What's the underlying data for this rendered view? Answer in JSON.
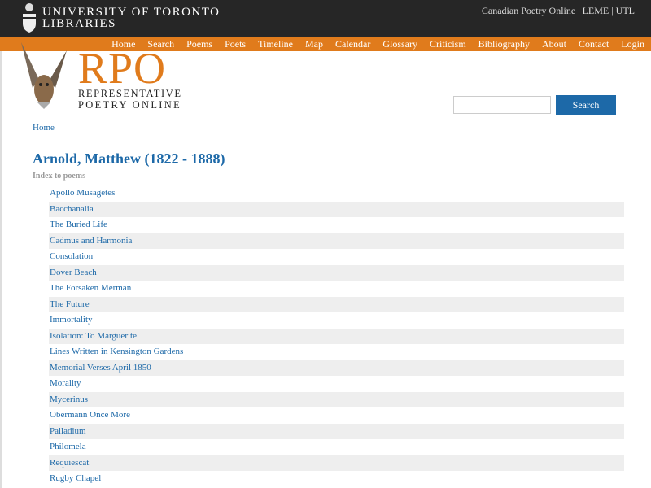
{
  "header": {
    "org_line1": "UNIVERSITY OF TORONTO",
    "org_line2": "LIBRARIES",
    "top_links": [
      "Canadian Poetry Online",
      "LEME",
      "UTL"
    ],
    "separator": "|"
  },
  "nav": [
    "Home",
    "Search",
    "Poems",
    "Poets",
    "Timeline",
    "Map",
    "Calendar",
    "Glossary",
    "Criticism",
    "Bibliography",
    "About",
    "Contact",
    "Login"
  ],
  "logo": {
    "title": "RPO",
    "line1": "REPRESENTATIVE",
    "line2": "POETRY ONLINE"
  },
  "search": {
    "value": "",
    "button": "Search"
  },
  "breadcrumb": "Home",
  "page_title": "Arnold, Matthew (1822 - 1888)",
  "subtitle": "Index to poems",
  "poems": [
    "Apollo Musagetes",
    "Bacchanalia",
    "The Buried Life",
    "Cadmus and Harmonia",
    "Consolation",
    "Dover Beach",
    "The Forsaken Merman",
    "The Future",
    "Immortality",
    "Isolation: To Marguerite",
    "Lines Written in Kensington Gardens",
    "Memorial Verses April 1850",
    "Morality",
    "Mycerinus",
    "Obermann Once More",
    "Palladium",
    "Philomela",
    "Requiescat",
    "Rugby Chapel"
  ],
  "colors": {
    "accent": "#e07b1c",
    "link": "#1d69a8",
    "header": "#262626"
  }
}
